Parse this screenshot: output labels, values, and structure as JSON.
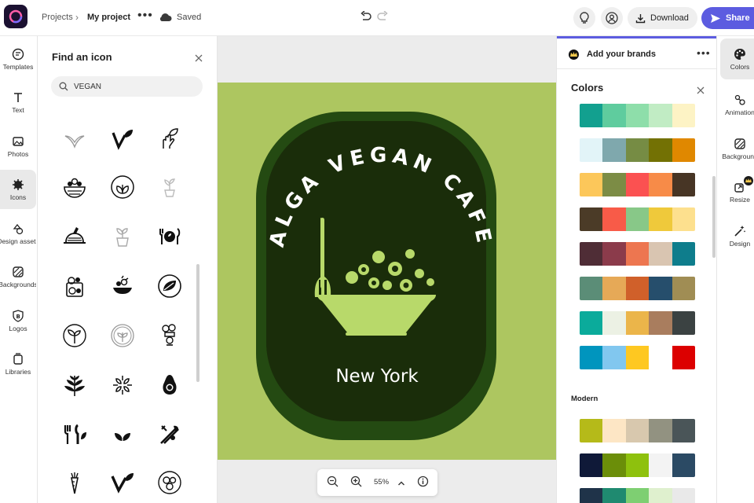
{
  "header": {
    "breadcrumb_root": "Projects",
    "project_name": "My project",
    "save_status": "Saved",
    "download_label": "Download",
    "share_label": "Share",
    "more_label": "•••"
  },
  "left_rail": {
    "items": [
      {
        "label": "Templates",
        "icon": "templates-icon"
      },
      {
        "label": "Text",
        "icon": "text-icon"
      },
      {
        "label": "Photos",
        "icon": "photos-icon"
      },
      {
        "label": "Icons",
        "icon": "icons-icon",
        "active": true
      },
      {
        "label": "Design assets",
        "icon": "design-assets-icon"
      },
      {
        "label": "Backgrounds",
        "icon": "backgrounds-icon"
      },
      {
        "label": "Logos",
        "icon": "logos-icon"
      },
      {
        "label": "Libraries",
        "icon": "libraries-icon"
      }
    ]
  },
  "icon_panel": {
    "title": "Find an icon",
    "search_value": "VEGAN",
    "icons": [
      "sprout-outline-icon",
      "vegan-v-leaf-icon",
      "hand-leaf-icon",
      "salad-bowl-icon",
      "leaf-circle-icon",
      "plant-pot-faded-icon",
      "vegetable-basket-icon",
      "plant-pot-icon",
      "fork-plate-knife-icon",
      "grocery-bag-icon",
      "salad-plate-icon",
      "leaf-round-icon",
      "sprout-circle-icon",
      "plant-circle-icon",
      "chef-hat-icon",
      "wheat-leaf-icon",
      "leaf-pattern-icon",
      "avocado-icon",
      "fork-knife-leaf-icon",
      "twin-leaf-icon",
      "crossed-utensils-icon",
      "carrot-icon",
      "vegan-v-icon",
      "vegetables-circle-icon"
    ]
  },
  "canvas": {
    "badge_arc_text": "ALGA VEGAN CAFE",
    "badge_city": "New York",
    "zoom_level": "55%",
    "colors": {
      "artboard": "#adc660",
      "badge_outer": "#244a12",
      "badge_inner": "#1a2d0a",
      "accent": "#b8d96a"
    }
  },
  "brands": {
    "label": "Add your brands"
  },
  "colors_panel": {
    "title": "Colors",
    "section_modern": "Modern",
    "palettes": [
      [
        "#12a08f",
        "#5fcc9e",
        "#8edeaa",
        "#c1ecc4",
        "#fdf3c5"
      ],
      [
        "#e2f4f8",
        "#7fa8ad",
        "#768c44",
        "#737104",
        "#e08800"
      ],
      [
        "#fcc75a",
        "#7c8c45",
        "#fb5151",
        "#f78b48",
        "#473525"
      ],
      [
        "#4b3b27",
        "#f85b48",
        "#88c888",
        "#efc93b",
        "#fde08e"
      ],
      [
        "#4f2d36",
        "#8b3b4b",
        "#ed7650",
        "#d9c5b1",
        "#0e7d8c"
      ],
      [
        "#5b8d77",
        "#e6a957",
        "#d0602a",
        "#264e6c",
        "#a08d54"
      ],
      [
        "#0bab9b",
        "#ecf1e4",
        "#ebb54a",
        "#a97d5e",
        "#3b4242"
      ],
      [
        "#0095be",
        "#81c7ef",
        "#fec821",
        "#ffffff",
        "#dc0000"
      ]
    ],
    "modern_palettes": [
      [
        "#b5ba19",
        "#fde6c5",
        "#d8c8ae",
        "#929281",
        "#4a5558"
      ],
      [
        "#0f1938",
        "#6b8e09",
        "#8ec10d",
        "#f3f3f3",
        "#2b4a64"
      ],
      [
        "#1f3349",
        "#1f8a70",
        "#7ecf72",
        "#dff0ce",
        "#e9e9e9"
      ]
    ]
  },
  "right_rail": {
    "items": [
      {
        "label": "Colors",
        "icon": "colors-icon",
        "active": true
      },
      {
        "label": "Animation",
        "icon": "animation-icon"
      },
      {
        "label": "Background",
        "icon": "background-icon"
      },
      {
        "label": "Resize",
        "icon": "resize-icon",
        "premium": true
      },
      {
        "label": "Design",
        "icon": "design-icon"
      }
    ]
  }
}
